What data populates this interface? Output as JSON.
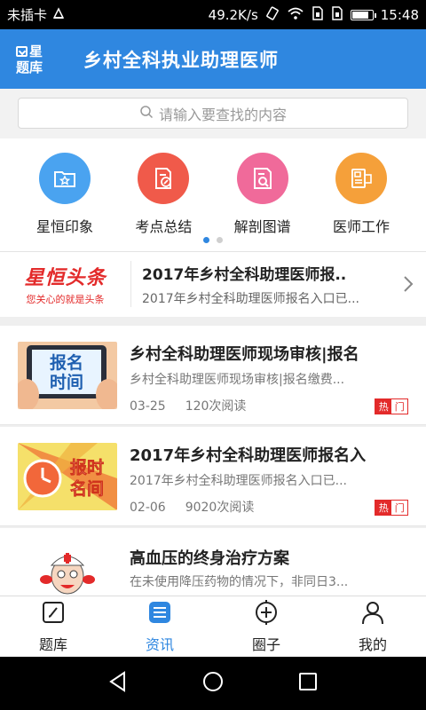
{
  "status_bar": {
    "carrier": "未插卡",
    "speed": "49.2K/s",
    "time": "15:48",
    "battery_level": 0.85
  },
  "header": {
    "logo_line1": "星",
    "logo_line2": "题库",
    "title": "乡村全科执业助理医师",
    "color": "#2f87e0"
  },
  "search": {
    "placeholder": "请输入要查找的内容"
  },
  "categories": [
    {
      "label": "星恒印象",
      "icon": "folder-star-icon",
      "color": "#4aa3f0"
    },
    {
      "label": "考点总结",
      "icon": "document-edit-icon",
      "color": "#f05a4a"
    },
    {
      "label": "解剖图谱",
      "icon": "document-search-icon",
      "color": "#f06a9a"
    },
    {
      "label": "医师工作",
      "icon": "id-card-icon",
      "color": "#f5a03a"
    }
  ],
  "pager": {
    "active": 0,
    "count": 2
  },
  "headline": {
    "brand": "星恒头条",
    "slogan": "您关心的就是头条",
    "title": "2017年乡村全科助理医师报..",
    "subtitle": "2017年乡村全科助理医师报名入口已..."
  },
  "news": [
    {
      "thumb_text": "报名时间",
      "title": "乡村全科助理医师现场审核|报名",
      "summary": "乡村全科助理医师现场审核|报名缴费...",
      "date": "03-25",
      "reads": "120次阅读",
      "hot_a": "热",
      "hot_b": "门"
    },
    {
      "thumb_text": "报时名间",
      "title": "2017年乡村全科助理医师报名入",
      "summary": "2017年乡村全科助理医师报名入口已...",
      "date": "02-06",
      "reads": "9020次阅读",
      "hot_a": "热",
      "hot_b": "门"
    },
    {
      "title": "高血压的终身治疗方案",
      "summary": "在未使用降压药物的情况下，非同日3..."
    }
  ],
  "bottom_nav": [
    {
      "label": "题库",
      "icon": "edit-board-icon",
      "active": false
    },
    {
      "label": "资讯",
      "icon": "news-icon",
      "active": true
    },
    {
      "label": "圈子",
      "icon": "plus-circle-icon",
      "active": false
    },
    {
      "label": "我的",
      "icon": "person-icon",
      "active": false
    }
  ]
}
